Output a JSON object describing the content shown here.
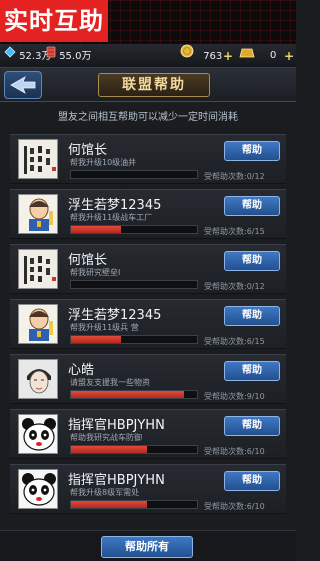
{
  "banner": {
    "label": "实时互助"
  },
  "resources": {
    "crystal": "52.3万",
    "oil": "55.0万",
    "gold": "763",
    "bars": "0"
  },
  "header": {
    "title": "联盟帮助"
  },
  "hint": "盟友之间相互帮助可以减少一定时间消耗",
  "count_prefix": "受帮助次数:",
  "help_label": "帮助",
  "help_all_label": "帮助所有",
  "requests": [
    {
      "name": "何馆长",
      "desc": "帮我升级10级油井",
      "count": "0/12",
      "progress": 0.0,
      "avatar": "calligraphy"
    },
    {
      "name": "浮生若梦12345",
      "desc": "帮我升级11级战车工厂",
      "count": "6/15",
      "progress": 0.4,
      "avatar": "cartoon"
    },
    {
      "name": "何馆长",
      "desc": "帮我研究壁垒I",
      "count": "0/12",
      "progress": 0.0,
      "avatar": "calligraphy"
    },
    {
      "name": "浮生若梦12345",
      "desc": "帮我升级11级兵 营",
      "count": "6/15",
      "progress": 0.4,
      "avatar": "cartoon"
    },
    {
      "name": "心皓",
      "desc": "请盟友支援我一些物资",
      "count": "9/10",
      "progress": 0.9,
      "avatar": "portrait"
    },
    {
      "name": "指挥官HBPJYHN",
      "desc": "帮助我研究战车防御",
      "count": "6/10",
      "progress": 0.6,
      "avatar": "panda"
    },
    {
      "name": "指挥官HBPJYHN",
      "desc": "帮我升级8级军需处",
      "count": "6/10",
      "progress": 0.6,
      "avatar": "panda"
    }
  ],
  "colors": {
    "banner_red": "#e52222",
    "progress_red": "#d03a2c",
    "button_blue": "#2f63a8",
    "title_gold": "#f2d9a0"
  }
}
